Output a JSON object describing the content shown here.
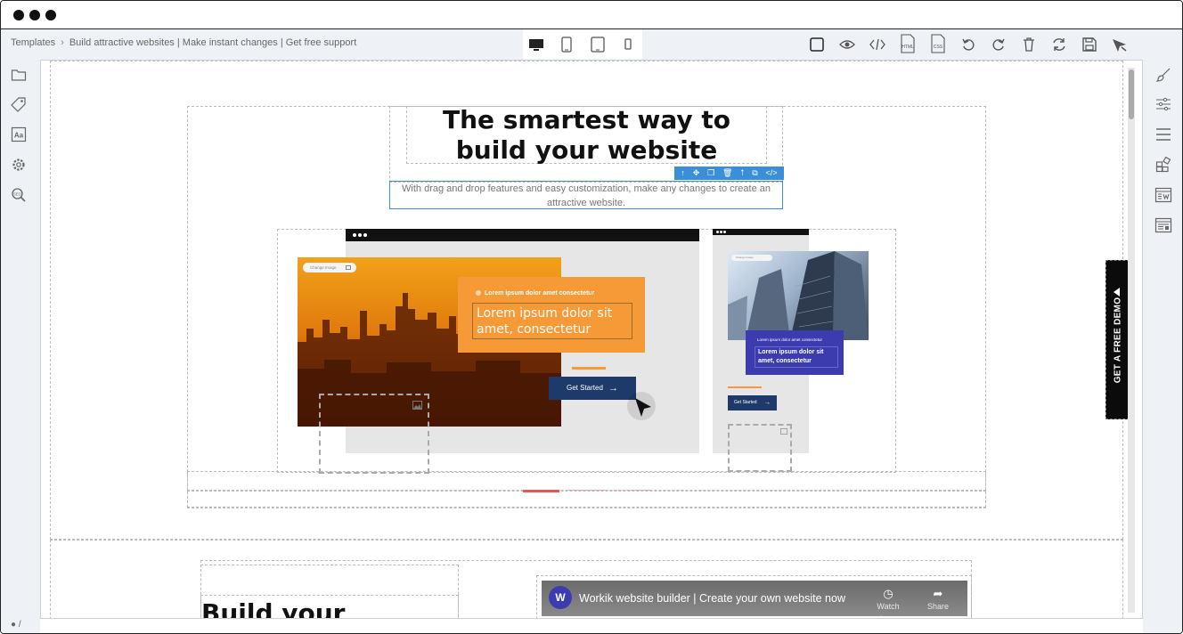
{
  "breadcrumb": {
    "root": "Templates",
    "separator": "›",
    "current": "Build attractive websites | Make instant changes | Get free support"
  },
  "toolbar": {
    "devices": [
      "desktop-icon",
      "tablet-portrait-icon",
      "tablet-icon",
      "mobile-icon"
    ],
    "actions": [
      "select-box-icon",
      "preview-eye-icon",
      "code-icon",
      "html-icon",
      "css-icon",
      "undo-icon",
      "redo-icon",
      "trash-icon",
      "refresh-icon",
      "save-icon",
      "publish-icon"
    ],
    "html_label": "HTML",
    "css_label": "CSS"
  },
  "left_rail": [
    "folder-icon",
    "tag-icon",
    "text-style-icon",
    "gear-icon",
    "seo-search-icon"
  ],
  "left_rail_seo_label": "SEO",
  "right_rail": [
    "brush-icon",
    "sliders-icon",
    "menu-icon",
    "blocks-icon",
    "widget-icon",
    "layout-icon"
  ],
  "hero": {
    "headline": "The smartest way to build your website",
    "subtext": "With drag and drop features and easy customization, make any changes to create an attractive website."
  },
  "selection_toolbar": [
    "↑",
    "✥",
    "❐",
    "🗑",
    "⭡",
    "⧉",
    "</>"
  ],
  "mockup_main": {
    "change_image": "Change Image",
    "card_kicker": "Lorem ipsum dolor amet consectetur",
    "card_title": "Lorem ipsum dolor sit amet, consectetur",
    "cta": "Get Started",
    "cta_arrow": "→"
  },
  "mockup_side": {
    "change_image": "Change Image",
    "card_kicker": "Lorem ipsum dolor amet consectetur",
    "card_title": "Lorem ipsum dolor sit amet, consectetur",
    "cta": "Get Started",
    "cta_arrow": "→"
  },
  "demo_tab": "GET A FREE DEMO",
  "slider": {
    "count": 3,
    "active_index": 0,
    "active_color": "#e05a5a"
  },
  "section2": {
    "heading": "Build your"
  },
  "video": {
    "avatar": "W",
    "title": "Workik website builder | Create your own website now",
    "watch_later": "Watch later",
    "share": "Share"
  },
  "status": "/",
  "colors": {
    "accent_blue": "#3b8fd8",
    "orange": "#f59a36",
    "navy": "#1d3a6b",
    "purple": "#3d3bb0"
  }
}
